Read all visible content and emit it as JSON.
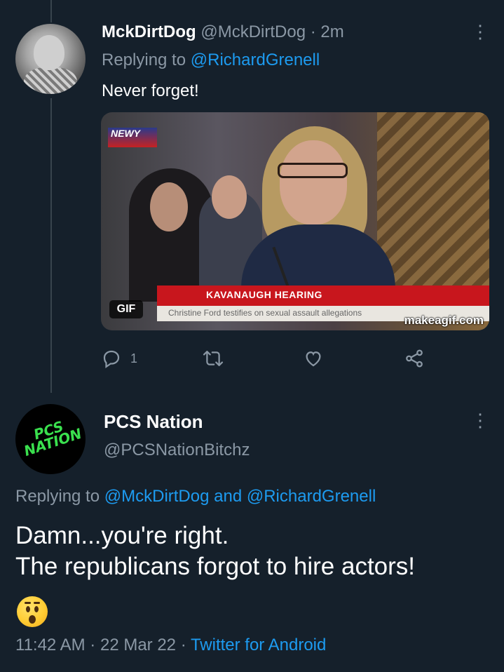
{
  "tweet1": {
    "display_name": "MckDirtDog",
    "handle": "@MckDirtDog",
    "separator": "·",
    "time": "2m",
    "replying_prefix": "Replying to",
    "replying_to": "@RichardGrenell",
    "text": "Never forget!",
    "media": {
      "badge": "GIF",
      "news_logo": "NEWY",
      "banner_title": "KAVANAUGH HEARING",
      "banner_subtext": "Christine Ford testifies on sexual assault allegations",
      "watermark": "makeagif.com"
    },
    "actions": {
      "reply_count": "1",
      "reply_icon": "reply-icon",
      "retweet_icon": "retweet-icon",
      "like_icon": "heart-icon",
      "share_icon": "share-icon"
    }
  },
  "tweet2": {
    "display_name": "PCS Nation",
    "handle": "@PCSNationBitchz",
    "avatar_text": "PCS NATION",
    "replying_prefix": "Replying to",
    "replying_to_1": "@MckDirtDog",
    "replying_and": "and",
    "replying_to_2": "@RichardGrenell",
    "text_line1": "Damn...you're right.",
    "text_line2": "The republicans forgot to hire actors!",
    "emoji": "hushed-face-emoji",
    "time": "11:42 AM",
    "separator": "·",
    "date": "22 Mar 22",
    "source": "Twitter for Android"
  },
  "colors": {
    "background": "#15202b",
    "secondary_text": "#8b98a5",
    "link": "#1d9bf0",
    "thread_line": "#38444d"
  }
}
